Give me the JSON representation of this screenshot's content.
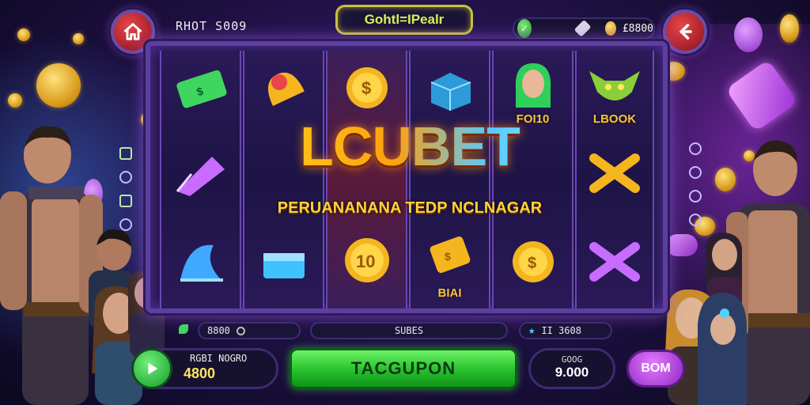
{
  "header": {
    "left_text": "RHOT S009",
    "title": "Gohtl=IPealr",
    "balance": "£8800"
  },
  "slot": {
    "reel_labels": {
      "r4_top": "FOI10",
      "r5_top": "LBOOK",
      "r4_bottom": "BIAI"
    },
    "coin_value": "10"
  },
  "logo": {
    "title": "LCUBET",
    "subtitle": "PERUANANANA TEDP NCLNAGAR"
  },
  "info_bar": {
    "left": "8800",
    "center": "SUBES",
    "right": "II 3608"
  },
  "controls": {
    "panel_label": "RGBI NOGRO",
    "panel_value": "4800",
    "spin_label": "TACGUPON",
    "bet_label": "GOOG",
    "bet_value": "9.000",
    "action_label": "BOM"
  },
  "colors": {
    "accent_purple": "#5d3fa0",
    "spin_green": "#25c02c",
    "gold": "#ffc21a",
    "danger_red": "#e8464a"
  }
}
